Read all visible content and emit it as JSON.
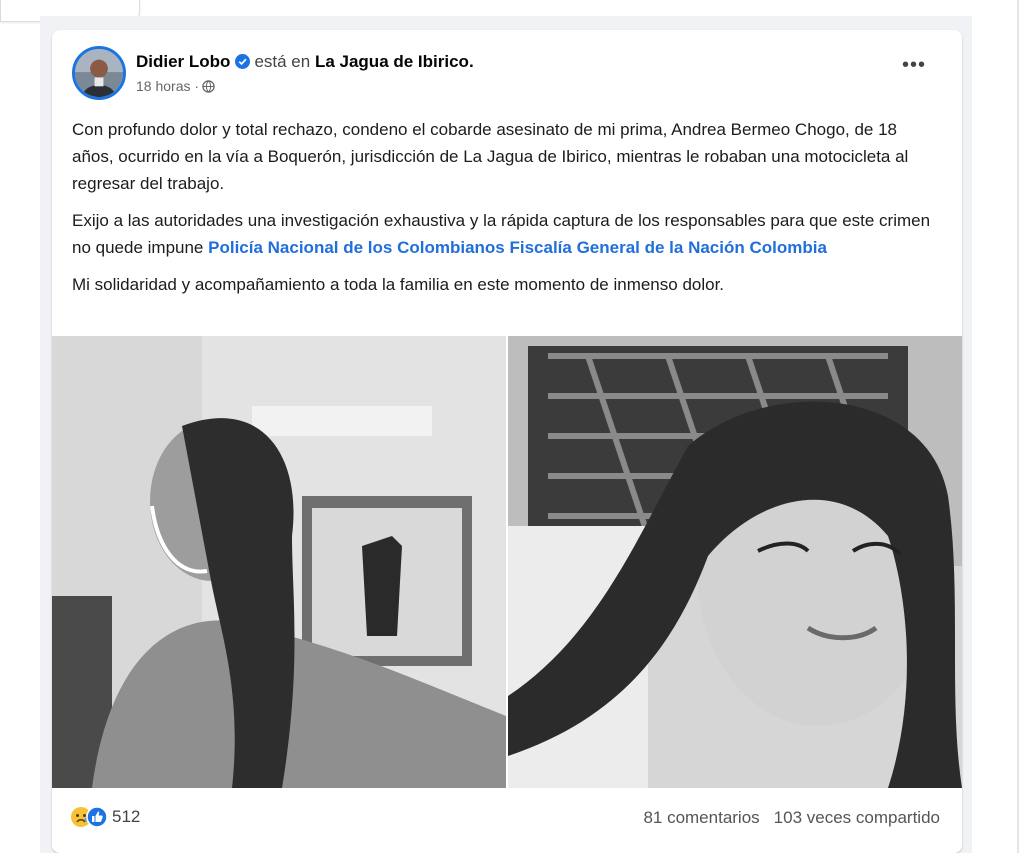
{
  "post": {
    "author": "Didier Lobo",
    "verb": "está en",
    "place": "La Jagua de Ibirico.",
    "time": "18 horas ·",
    "more_label": "•••",
    "paragraph1": "Con profundo dolor y total rechazo, condeno el cobarde asesinato de mi prima, Andrea Bermeo Chogo, de 18 años, ocurrido en la vía a Boquerón, jurisdicción de La Jagua de Ibirico, mientras le robaban una motocicleta al regresar del trabajo.",
    "paragraph2_text": "Exijo a las autoridades una investigación exhaustiva y la rápida captura de los responsables para que este crimen no quede impune",
    "paragraph2_links": [
      "Policía Nacional de los Colombianos",
      "Fiscalía General de la Nación Colombia"
    ],
    "paragraph3": "Mi solidaridad y acompañamiento a toda la familia en este momento de inmenso dolor.",
    "reaction_count": "512",
    "comments": "81 comentarios",
    "shares": "103 veces compartido"
  },
  "icons": {
    "verified": "verified-badge-icon",
    "privacy": "globe-icon",
    "reactions": [
      "sad-reaction-icon",
      "like-reaction-icon"
    ]
  },
  "colors": {
    "link": "#216fdb",
    "verified": "#1b74e4",
    "background": "#f0f2f5"
  }
}
